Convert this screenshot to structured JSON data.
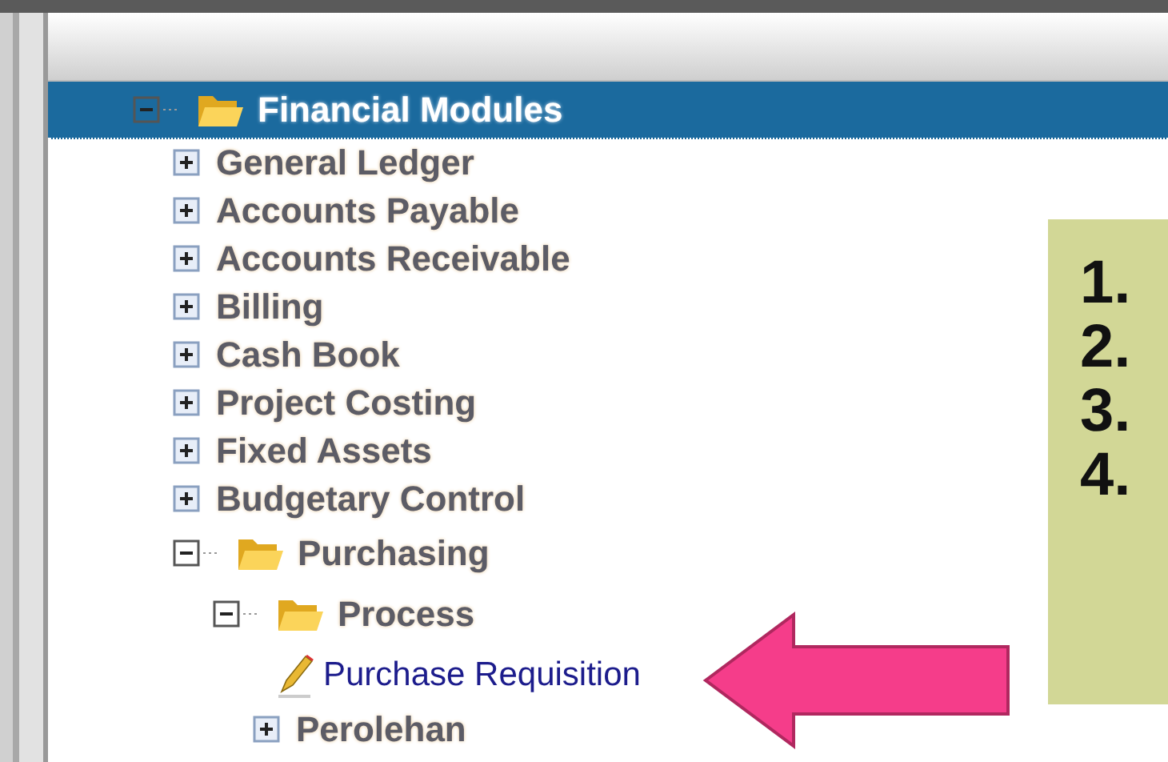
{
  "tree": [
    {
      "label": "Financial Modules",
      "kind": "folder",
      "expanded": true,
      "selected": true,
      "children": [
        {
          "label": "General Ledger",
          "kind": "module",
          "expanded": false,
          "selected": false
        },
        {
          "label": "Accounts Payable",
          "kind": "module",
          "expanded": false,
          "selected": false
        },
        {
          "label": "Accounts Receivable",
          "kind": "module",
          "expanded": false,
          "selected": false
        },
        {
          "label": "Billing",
          "kind": "module",
          "expanded": false,
          "selected": false
        },
        {
          "label": "Cash Book",
          "kind": "module",
          "expanded": false,
          "selected": false
        },
        {
          "label": "Project Costing",
          "kind": "module",
          "expanded": false,
          "selected": false
        },
        {
          "label": "Fixed Assets",
          "kind": "module",
          "expanded": false,
          "selected": false
        },
        {
          "label": "Budgetary Control",
          "kind": "module",
          "expanded": false,
          "selected": false
        },
        {
          "label": "Purchasing",
          "kind": "folder",
          "expanded": true,
          "selected": false,
          "children": [
            {
              "label": "Process",
              "kind": "folder",
              "expanded": true,
              "selected": false,
              "children": [
                {
                  "label": "Purchase Requisition",
                  "kind": "document",
                  "selected": false
                },
                {
                  "label": "Perolehan",
                  "kind": "module",
                  "expanded": false,
                  "selected": false
                }
              ]
            }
          ]
        }
      ]
    }
  ],
  "note": {
    "items": [
      "1.",
      "2.",
      "3.",
      "4."
    ]
  }
}
